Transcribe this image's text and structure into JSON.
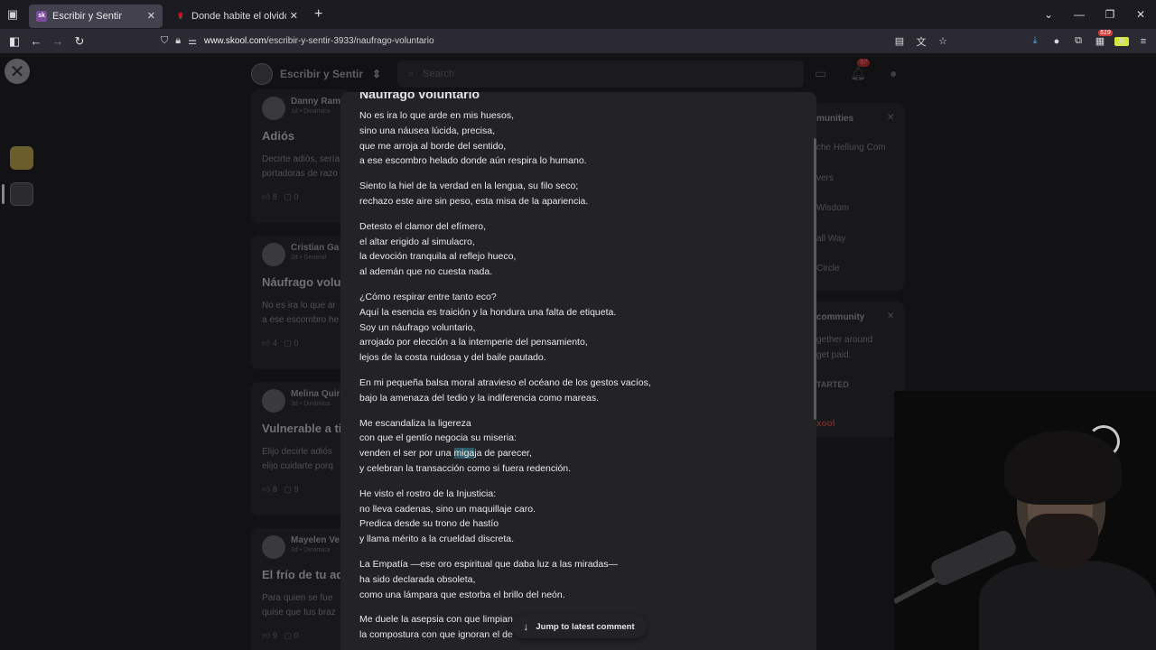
{
  "browser": {
    "tabs": [
      {
        "label": "Escribir y Sentir",
        "favicon": "skool-icon",
        "active": true
      },
      {
        "label": "Donde habite el olvido - Poema",
        "favicon": "rose-icon",
        "active": false
      }
    ],
    "url": {
      "host": "www.skool.com",
      "path": "/escribir-y-sentir-3933/naufrago-voluntario"
    },
    "extension_badge": "519",
    "extension_letter": "R"
  },
  "background": {
    "group_name": "Escribir y Sentir",
    "search_placeholder": "Search",
    "notification_count": "97",
    "posts": [
      {
        "author": "Danny Ram",
        "meta": "1d • Dinámica",
        "title": "Adiós",
        "excerpt1": "Decirte adiós, sería",
        "excerpt2": "portadoras de razo",
        "likes": "8",
        "comments": "0"
      },
      {
        "author": "Cristian Ga",
        "meta": "2d • General",
        "title": "Náufrago volun",
        "excerpt1": "No es ira lo que ar",
        "excerpt2": "a ese escombro he",
        "likes": "4",
        "comments": "0"
      },
      {
        "author": "Melina Quir",
        "meta": "3d • Dinámica",
        "title": "Vulnerable a ti",
        "excerpt1": "Elijo decirle adiós",
        "excerpt2": "elijo cuidarte porq",
        "likes": "8",
        "comments": "9"
      },
      {
        "author": "Mayelen Ve",
        "meta": "3d • Dinámica",
        "title": "El frío de tu ad",
        "excerpt1": "Para quien se fue",
        "excerpt2": "quise que tus braz",
        "likes": "9",
        "comments": "0"
      }
    ],
    "right_panel_1": {
      "heading": "munities",
      "items": [
        "che Hellung Com",
        "vers",
        "Wisdom",
        "all Way",
        "Circle"
      ]
    },
    "right_panel_2": {
      "heading": "community",
      "lines": [
        "gether around",
        "get paid."
      ],
      "cta": "TARTED",
      "footer": "xool"
    }
  },
  "modal": {
    "title": "Náufrago voluntario",
    "stanzas": [
      [
        "No es ira lo que arde en mis huesos,",
        "sino una náusea lúcida, precisa,",
        "que me arroja al borde del sentido,",
        "a ese escombro helado donde aún respira lo humano."
      ],
      [
        "Siento la hiel de la verdad en la lengua, su filo seco;",
        "rechazo este aire sin peso, esta misa de la apariencia."
      ],
      [
        "Detesto el clamor del efímero,",
        "el altar erigido al simulacro,",
        "la devoción tranquila al reflejo hueco,",
        "al ademán que no cuesta nada."
      ],
      [
        "¿Cómo respirar entre tanto eco?",
        "Aquí la esencia es traición y la hondura una falta de etiqueta.",
        "Soy un náufrago voluntario,",
        "arrojado por elección a la intemperie del pensamiento,",
        "lejos de la costa ruidosa y del baile pautado."
      ],
      [
        "En mi pequeña balsa moral atravieso el océano de los gestos vacíos,",
        "bajo la amenaza del tedio y la indiferencia como mareas."
      ],
      [
        "Me escandaliza la ligereza",
        "con que el gentío negocia su miseria:",
        "venden el ser por una ",
        "y celebran la transacción como si fuera redención."
      ],
      [
        "He visto el rostro de la Injusticia:",
        "no lleva cadenas, sino un maquillaje caro.",
        "Predica desde su trono de hastío",
        "y llama mérito a la crueldad discreta."
      ],
      [
        "La Empatía —ese oro espiritual que daba luz a las miradas—",
        "ha sido declarada obsoleta,",
        "como una lámpara que estorba el brillo del neón."
      ],
      [
        "Me duele la asepsia con que limpian",
        "la compostura con que ignoran el de"
      ]
    ],
    "highlight_word": "miga",
    "highlight_rest": "ja de parecer,",
    "jump_label": "Jump to latest comment"
  }
}
